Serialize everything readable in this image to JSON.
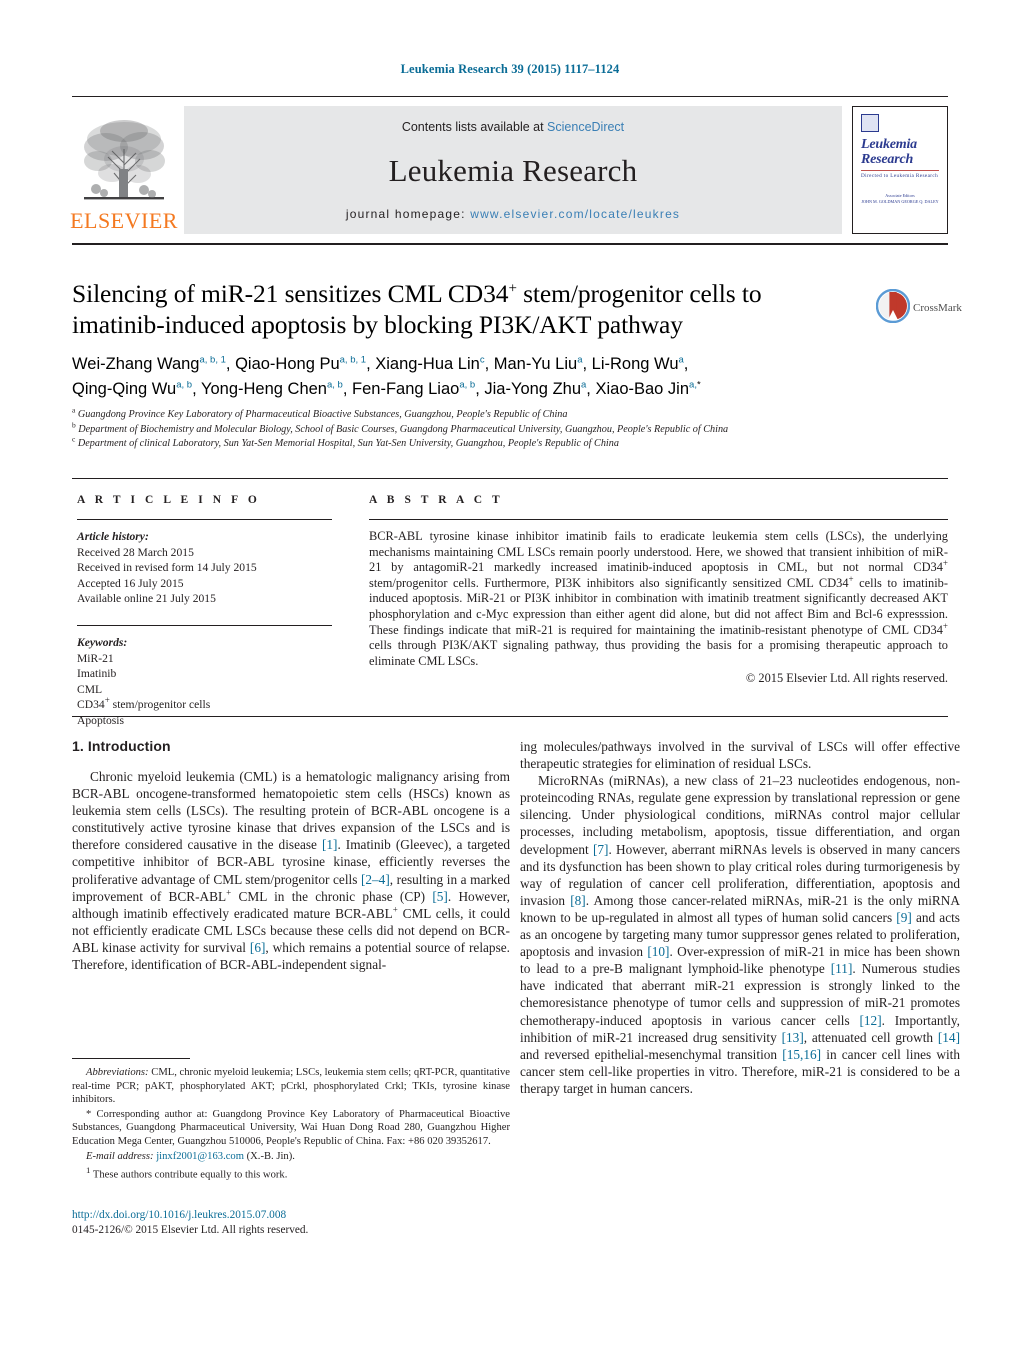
{
  "running_head": "Leukemia Research 39 (2015) 1117–1124",
  "header": {
    "publisher_name": "ELSEVIER",
    "contents_prefix": "Contents lists available at ",
    "contents_link": "ScienceDirect",
    "journal_title": "Leukemia Research",
    "homepage_label": "journal homepage: ",
    "homepage_url": "www.elsevier.com/locate/leukres",
    "cover": {
      "title_line1": "Leukemia",
      "title_line2": "Research",
      "subtitle": "Directed to Leukemia Research",
      "footer_line1": "Associate Editors",
      "footer_line2": "JOHN M. GOLDMAN      GEORGE Q. DALEY"
    }
  },
  "article": {
    "title_line1": "Silencing of miR-21 sensitizes CML CD34",
    "title_sup1": "+",
    "title_line1b": " stem/progenitor cells to",
    "title_line2": "imatinib-induced apoptosis by blocking PI3K/AKT pathway",
    "crossmark_label": "CrossMark",
    "authors": [
      {
        "name": "Wei-Zhang Wang",
        "sup": "a, b, 1",
        "sep": ", "
      },
      {
        "name": "Qiao-Hong Pu",
        "sup": "a, b, 1",
        "sep": ", "
      },
      {
        "name": "Xiang-Hua Lin",
        "sup": "c",
        "sep": ", "
      },
      {
        "name": "Man-Yu Liu",
        "sup": "a",
        "sep": ", "
      },
      {
        "name": "Li-Rong Wu",
        "sup": "a",
        "sep": ", "
      },
      {
        "name": "Qing-Qing Wu",
        "sup": "a, b",
        "sep": ", "
      },
      {
        "name": "Yong-Heng Chen",
        "sup": "a, b",
        "sep": ", "
      },
      {
        "name": "Fen-Fang Liao",
        "sup": "a, b",
        "sep": ", "
      },
      {
        "name": "Jia-Yong Zhu",
        "sup": "a",
        "sep": ", "
      },
      {
        "name": "Xiao-Bao Jin",
        "sup": "a,",
        "sup_star": "*",
        "sep": ""
      }
    ],
    "affiliations": [
      {
        "marker": "a",
        "text": "Guangdong Province Key Laboratory of Pharmaceutical Bioactive Substances, Guangzhou, People's Republic of China"
      },
      {
        "marker": "b",
        "text": "Department of Biochemistry and Molecular Biology, School of Basic Courses, Guangdong Pharmaceutical University, Guangzhou, People's Republic of China"
      },
      {
        "marker": "c",
        "text": "Department of clinical Laboratory, Sun Yat-Sen Memorial Hospital, Sun Yat-Sen University, Guangzhou, People's Republic of China"
      }
    ]
  },
  "article_info": {
    "heading": "A R T I C L E   I N F O",
    "history_label": "Article history:",
    "history": [
      "Received 28 March 2015",
      "Received in revised form 14 July 2015",
      "Accepted 16 July 2015",
      "Available online 21 July 2015"
    ],
    "keywords_label": "Keywords:",
    "keywords_plain": [
      "MiR-21",
      "Imatinib",
      "CML",
      "Apoptosis"
    ],
    "keyword_cd34_prefix": "CD34",
    "keyword_cd34_sup": "+",
    "keyword_cd34_suffix": " stem/progenitor cells"
  },
  "abstract": {
    "heading": "A B S T R A C T",
    "p1_a": "BCR-ABL tyrosine kinase inhibitor imatinib fails to eradicate leukemia stem cells (LSCs), the underlying mechanisms maintaining CML LSCs remain poorly understood. Here, we showed that transient inhibition of miR-21 by antagomiR-21 markedly increased imatinib-induced apoptosis in CML, but not normal CD34",
    "sup1": "+",
    "p1_b": " stem/progenitor cells. Furthermore, PI3K inhibitors also significantly sensitized CML CD34",
    "sup2": "+",
    "p1_c": " cells to imatinib-induced apoptosis. MiR-21 or PI3K inhibitor in combination with imatinib treatment significantly decreased AKT phosphorylation and c-Myc expression than either agent did alone, but did not affect Bim and Bcl-6 expresssion. These findings indicate that miR-21 is required for maintaining the imatinib-resistant phenotype of CML CD34",
    "sup3": "+",
    "p1_d": " cells through PI3K/AKT signaling pathway, thus providing the basis for a promising therapeutic approach to eliminate CML LSCs.",
    "copyright": "© 2015 Elsevier Ltd. All rights reserved."
  },
  "body": {
    "section_title": "1. Introduction",
    "left_p1_parts": {
      "t1": "Chronic myeloid leukemia (CML) is a hematologic malignancy arising from BCR-ABL oncogene-transformed hematopoietic stem cells (HSCs) known as leukemia stem cells (LSCs). The resulting protein of BCR-ABL oncogene is a constitutively active tyrosine kinase that drives expansion of the LSCs and is therefore considered causative in the disease ",
      "r1": "[1]",
      "t2": ". Imatinib (Gleevec), a targeted competitive inhibitor of BCR-ABL tyrosine kinase, efficiently reverses the proliferative advantage of CML stem/progenitor cells ",
      "r2": "[2–4]",
      "t3": ", resulting in a marked improvement of BCR-ABL",
      "sup1": "+",
      "t4": " CML in the chronic phase (CP) ",
      "r3": "[5]",
      "t5": ". However, although imatinib effectively eradicated mature BCR-ABL",
      "sup2": "+",
      "t6": " CML cells, it could not efficiently eradicate CML LSCs because these cells did not depend on BCR-ABL kinase activity for survival ",
      "r4": "[6]",
      "t7": ", which remains a potential source of relapse. Therefore, identification of BCR-ABL-independent signal-"
    },
    "right_p1_cont": "ing molecules/pathways involved in the survival of LSCs will offer effective therapeutic strategies for elimination of residual LSCs.",
    "right_p2_parts": {
      "t1": "MicroRNAs (miRNAs), a new class of 21–23 nucleotides endogenous, non-proteincoding RNAs, regulate gene expression by translational repression or gene silencing. Under physiological conditions, miRNAs control major cellular processes, including metabolism, apoptosis, tissue differentiation, and organ development ",
      "r1": "[7]",
      "t2": ". However, aberrant miRNAs levels is observed in many cancers and its dysfunction has been shown to play critical roles during turmorigenesis by way of regulation of cancer cell proliferation, differentiation, apoptosis and invasion ",
      "r2": "[8]",
      "t3": ". Among those cancer-related miRNAs, miR-21 is the only miRNA known to be up-regulated in almost all types of human solid cancers ",
      "r3": "[9]",
      "t4": " and acts as an oncogene by targeting many tumor suppressor genes related to proliferation, apoptosis and invasion ",
      "r4": "[10]",
      "t5": ". Over-expression of miR-21 in mice has been shown to lead to a pre-B malignant lymphoid-like phenotype ",
      "r5": "[11]",
      "t6": ". Numerous studies have indicated that aberrant miR-21 expression is strongly linked to the chemoresistance phenotype of tumor cells and suppression of miR-21 promotes chemotherapy-induced apoptosis in various cancer cells ",
      "r6": "[12]",
      "t7": ". Importantly, inhibition of miR-21 increased drug sensitivity ",
      "r7": "[13]",
      "t8": ", attenuated cell growth ",
      "r8": "[14]",
      "t9": " and reversed epithelial-mesenchymal transition ",
      "r9": "[15,16]",
      "t10": " in cancer cell lines with cancer stem cell-like properties in vitro. Therefore, miR-21 is considered to be a therapy target in human cancers."
    }
  },
  "footnotes": {
    "abbrev_label": "Abbreviations:",
    "abbrev_text": " CML, chronic myeloid leukemia; LSCs, leukemia stem cells; qRT-PCR, quantitative real-time PCR; pAKT, phosphorylated AKT; pCrkl, phosphorylated Crkl; TKIs, tyrosine kinase inhibitors.",
    "corresponding_marker": "*",
    "corresponding_text": " Corresponding author at: Guangdong Province Key Laboratory of Pharmaceutical Bioactive Substances, Guangdong Pharmaceutical University, Wai Huan Dong Road 280, Guangzhou Higher Education Mega Center, Guangzhou 510006, People's Republic of China. Fax: +86 020 39352617.",
    "email_label": "E-mail address:",
    "email_value": " jinxf2001@163.com",
    "email_suffix": " (X.-B. Jin).",
    "equal_marker": "1",
    "equal_text": " These authors contribute equally to this work."
  },
  "footer": {
    "doi": "http://dx.doi.org/10.1016/j.leukres.2015.07.008",
    "issn": "0145-2126/© 2015 Elsevier Ltd. All rights reserved."
  },
  "colors": {
    "link": "#0a6c96",
    "elsevier_orange": "#f47920",
    "banner_bg": "#e6e7e8",
    "sciencedirect_blue": "#3a7fb5"
  }
}
